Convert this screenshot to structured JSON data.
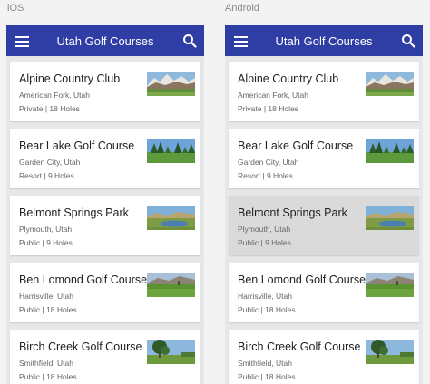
{
  "labels": {
    "ios": "iOS",
    "android": "Android"
  },
  "app": {
    "title": "Utah Golf Courses"
  },
  "icons": {
    "menu": "hamburger-menu-icon",
    "search": "search-icon"
  },
  "colors": {
    "appbar": "#2f3ea5",
    "pressed": "#dadada"
  },
  "courses": [
    {
      "name": "Alpine Country Club",
      "location": "American Fork, Utah",
      "info": "Private | 18 Holes",
      "thumb": "mountains"
    },
    {
      "name": "Bear Lake Golf Course",
      "location": "Garden City, Utah",
      "info": "Resort | 9 Holes",
      "thumb": "trees"
    },
    {
      "name": "Belmont Springs Park",
      "location": "Plymouth, Utah",
      "info": "Public | 9 Holes",
      "thumb": "lake"
    },
    {
      "name": "Ben Lomond Golf Course",
      "location": "Harrisville, Utah",
      "info": "Public | 18 Holes",
      "thumb": "fairway"
    },
    {
      "name": "Birch Creek Golf Course",
      "location": "Smithfield, Utah",
      "info": "Public | 18 Holes",
      "thumb": "tree"
    }
  ],
  "android_pressed_index": 2
}
